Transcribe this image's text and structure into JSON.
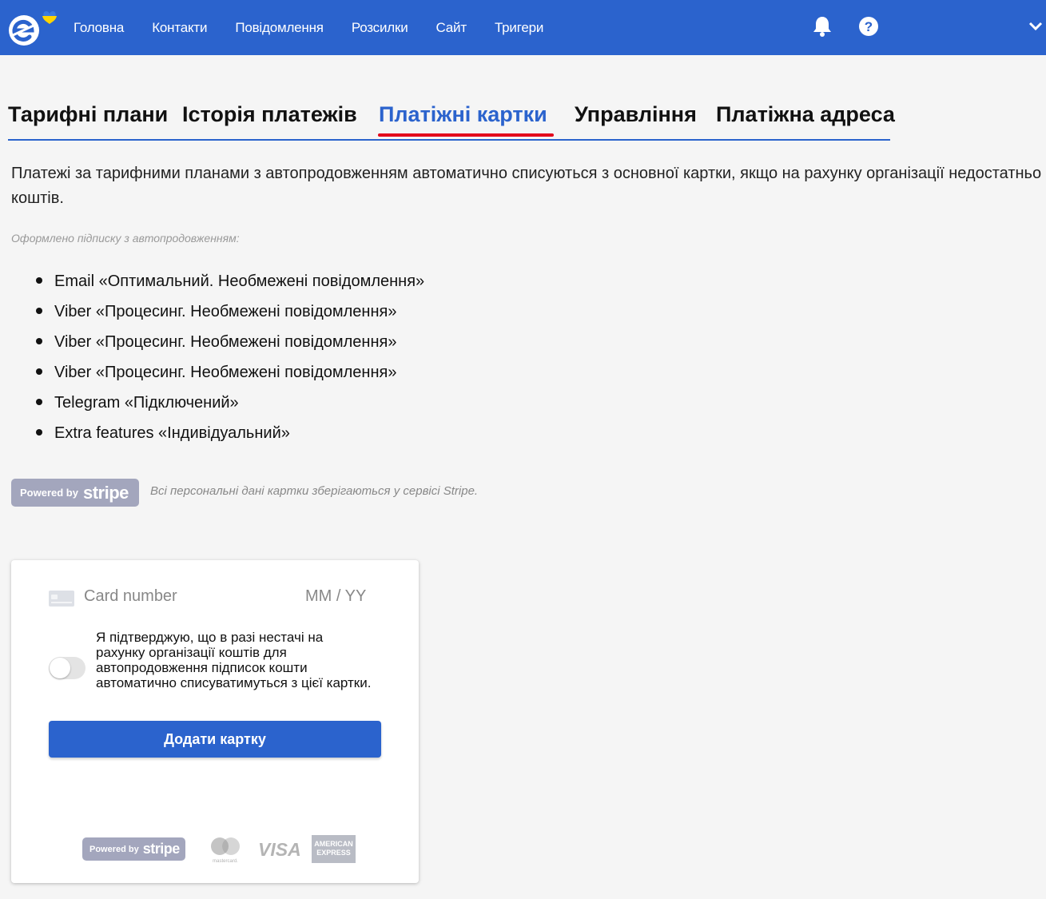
{
  "nav": {
    "items": [
      {
        "label": "Головна"
      },
      {
        "label": "Контакти"
      },
      {
        "label": "Повідомлення"
      },
      {
        "label": "Розсилки"
      },
      {
        "label": "Сайт"
      },
      {
        "label": "Тригери"
      }
    ]
  },
  "tabs": [
    {
      "label": "Тарифні плани"
    },
    {
      "label": "Історія платежів"
    },
    {
      "label": "Платіжні картки"
    },
    {
      "label": "Управління"
    },
    {
      "label": "Платіжна адреса"
    }
  ],
  "active_tab": "Платіжні картки",
  "intro": "Платежі за тарифними планами з автопродовженням автоматично списуються з основної картки, якщо на рахунку організації недостатньо коштів.",
  "subscriptions_heading": "Оформлено підписку з автопродовженням:",
  "subscriptions": [
    "Email «Оптимальний. Необмежені повідомлення»",
    "Viber «Процесинг. Необмежені повідомлення»",
    "Viber «Процесинг. Необмежені повідомлення»",
    "Viber «Процесинг. Необмежені повідомлення»",
    "Telegram «Підключений»",
    "Extra features «Індивідуальний»"
  ],
  "stripe": {
    "powered_by": "Powered by",
    "brand": "stripe",
    "note": "Всі персональні дані картки зберігаються у сервісі Stripe."
  },
  "card_form": {
    "card_number_placeholder": "Card number",
    "expiry_placeholder": "MM / YY",
    "consent": "Я підтверджую, що в разі нестачі на рахунку організації коштів для автопродовження підписок кошти автоматично списуватимуться з цієї картки.",
    "consent_on": false,
    "add_button": "Додати картку",
    "card_brands": {
      "mastercard": "mastercard.",
      "visa": "VISA",
      "amex_line1": "AMERICAN",
      "amex_line2": "EXPRESS"
    }
  },
  "colors": {
    "primary": "#2b63cd",
    "active_underline": "#e3001b",
    "stripe_badge": "#a3a6bd"
  }
}
